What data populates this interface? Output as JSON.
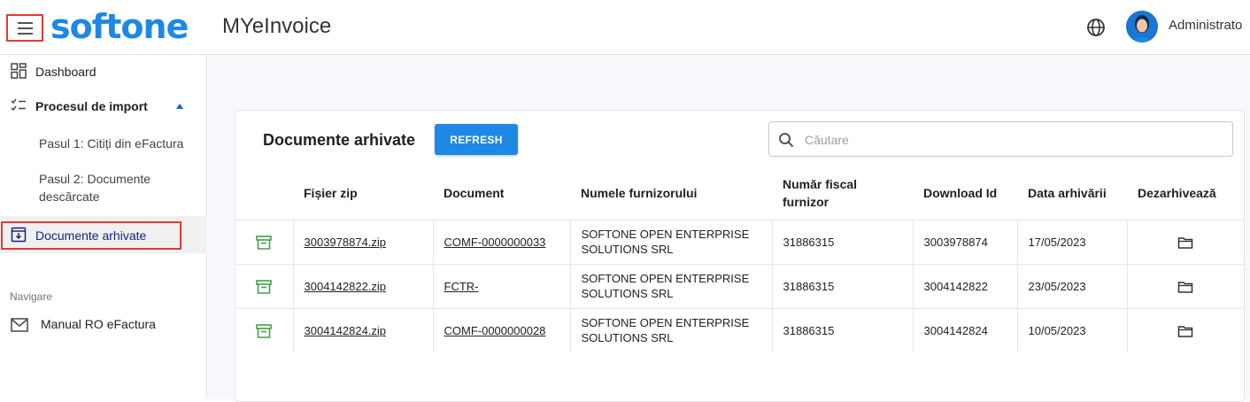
{
  "header": {
    "brand": "softone",
    "app_name": "MYeInvoice",
    "user_name": "Administrato",
    "icons": {
      "menu": "hamburger-icon",
      "language": "globe-icon",
      "user": "avatar-icon"
    },
    "brand_color": "#1e88e5"
  },
  "sidebar": {
    "items": [
      {
        "label": "Dashboard",
        "icon": "dashboard-icon"
      },
      {
        "label": "Procesul de import",
        "icon": "checklist-icon",
        "expanded": true
      },
      {
        "label": "Pasul 1: Citiți din eFactura"
      },
      {
        "label": "Pasul 2: Documente descărcate"
      },
      {
        "label": "Documente arhivate",
        "icon": "archive-download-icon",
        "active": true
      }
    ],
    "section_label": "Navigare",
    "nav_items": [
      {
        "label": "Manual RO eFactura",
        "icon": "mail-icon"
      }
    ]
  },
  "main": {
    "title": "Documente arhivate",
    "refresh_label": "REFRESH",
    "search_placeholder": "Căutare",
    "columns": [
      "Fișier zip",
      "Document",
      "Numele furnizorului",
      "Număr fiscal furnizor",
      "Download Id",
      "Data arhivării",
      "Dezarhivează"
    ],
    "rows": [
      {
        "zip": "3003978874.zip",
        "document": "COMF-0000000033",
        "supplier": "SOFTONE OPEN ENTERPRISE SOLUTIONS SRL",
        "fiscal": "31886315",
        "download_id": "3003978874",
        "date": "17/05/2023"
      },
      {
        "zip": "3004142822.zip",
        "document": "FCTR-",
        "supplier": "SOFTONE OPEN ENTERPRISE SOLUTIONS SRL",
        "fiscal": "31886315",
        "download_id": "3004142822",
        "date": "23/05/2023"
      },
      {
        "zip": "3004142824.zip",
        "document": "COMF-0000000028",
        "supplier": "SOFTONE OPEN ENTERPRISE SOLUTIONS SRL",
        "fiscal": "31886315",
        "download_id": "3004142824",
        "date": "10/05/2023"
      }
    ],
    "row_icons": {
      "archive": "archive-icon",
      "unarchive": "folder-icon"
    },
    "colors": {
      "accent": "#1e88e5",
      "archive_icon": "#43a047",
      "highlight": "#e53935"
    }
  }
}
